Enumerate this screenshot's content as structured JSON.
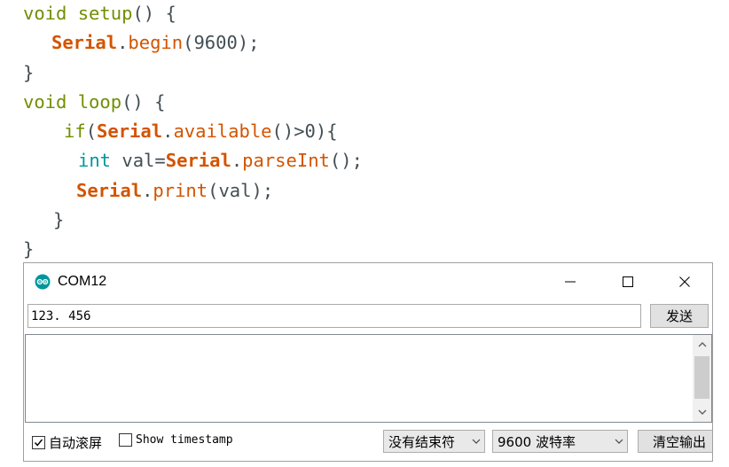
{
  "editor": {
    "lines": [
      {
        "kw1": "void",
        "name": "setup",
        "rest": "() {"
      },
      {
        "obj": "Serial",
        "dot": ".",
        "fn": "begin",
        "rest": "(9600);"
      },
      {
        "rest": "}"
      },
      {
        "kw1": "void",
        "name": "loop",
        "rest": "() {"
      },
      {
        "kw1": "if",
        "open": "(",
        "obj": "Serial",
        "dot": ".",
        "fn": "available",
        "rest": "()>0){"
      },
      {
        "tp": "int",
        "mid": " val=",
        "obj": "Serial",
        "dot": ".",
        "fn": "parseInt",
        "rest": "();"
      },
      {
        "obj": "Serial",
        "dot": ".",
        "fn": "print",
        "rest": "(val);"
      },
      {
        "rest": "}"
      },
      {
        "rest": "}"
      }
    ]
  },
  "monitor": {
    "title": "COM12",
    "icon": "arduino-logo-icon",
    "window_controls": [
      "minimize-icon",
      "maximize-icon",
      "close-icon"
    ],
    "send_input_value": "123. 456",
    "send_label": "发送",
    "autoscroll_label": "自动滚屏",
    "autoscroll_checked": true,
    "timestamp_label": "Show timestamp",
    "timestamp_checked": false,
    "line_ending": "没有结束符",
    "baud_rate": "9600 波特率",
    "clear_label": "清空输出"
  },
  "colors": {
    "keyword": "#728e00",
    "object": "#d35400",
    "type": "#00979c",
    "plain": "#434f54"
  }
}
